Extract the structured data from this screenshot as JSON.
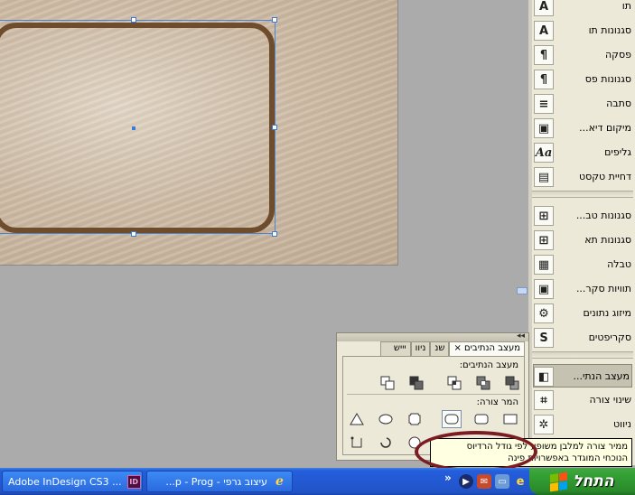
{
  "right_panel": {
    "items": [
      {
        "label": "תו",
        "icon": "character-icon",
        "glyph": "A"
      },
      {
        "label": "סגנונות תו",
        "icon": "character-styles-icon",
        "glyph": "A"
      },
      {
        "label": "פסקה",
        "icon": "paragraph-icon",
        "glyph": "¶"
      },
      {
        "label": "סגנונות פס",
        "icon": "paragraph-styles-icon",
        "glyph": "¶"
      },
      {
        "label": "סתבה",
        "icon": "story-icon",
        "glyph": "≡"
      },
      {
        "label": "מיקום דיא...",
        "icon": "image-position-icon",
        "glyph": "▣"
      },
      {
        "label": "גליפים",
        "icon": "glyphs-icon",
        "glyph": "Aa"
      },
      {
        "label": "דחיית טקסט",
        "icon": "text-wrap-icon",
        "glyph": "▤"
      },
      {
        "label": "סגנונות טב...",
        "icon": "table-styles-icon",
        "glyph": "⊞"
      },
      {
        "label": "סגנונות תא",
        "icon": "cell-styles-icon",
        "glyph": "⊞"
      },
      {
        "label": "טבלה",
        "icon": "table-icon",
        "glyph": "▦"
      },
      {
        "label": "תוויות סקר...",
        "icon": "captions-icon",
        "glyph": "▣"
      },
      {
        "label": "מיזוג נתונים",
        "icon": "data-merge-icon",
        "glyph": "⚙"
      },
      {
        "label": "סקריפטים",
        "icon": "scripts-icon",
        "glyph": "S"
      },
      {
        "label": "מעצב הנתי...",
        "icon": "pathfinder-icon",
        "glyph": "◧"
      },
      {
        "label": "שינוי צורה",
        "icon": "transform-icon",
        "glyph": "⌗"
      },
      {
        "label": "ניווט",
        "icon": "navigator-icon",
        "glyph": "✲"
      }
    ]
  },
  "pathfinder": {
    "tabs": [
      {
        "label": "מעצב הנתיבים"
      },
      {
        "label": "שנ"
      },
      {
        "label": "ניוו"
      },
      {
        "label": "יייש"
      }
    ],
    "close_glyph": "×",
    "collapse_glyph": "◂◂",
    "section_paths": "מעצב הנתיבים:",
    "section_convert": "המר צורה:"
  },
  "tooltip": {
    "line1": "ממיר צורה למלבן משופע לפי גודל הרדיוס",
    "line2": "הנוכחי המוגדר באפשרויות פינה"
  },
  "taskbar": {
    "start_label": "התחל",
    "tasks": [
      {
        "label": "... Adobe InDesign CS3",
        "icon": "indesign-icon",
        "badge": "ID"
      },
      {
        "label": "עיצוב גרפי - p - Prog...",
        "icon": "internet-explorer-icon",
        "badge": "e"
      }
    ],
    "tray_chevron": "»"
  },
  "colors": {
    "frame_stroke": "#6e4c2c",
    "selection": "#4a86d8",
    "taskbar": "#245edc",
    "start": "#36a336",
    "highlight": "#7a1c22"
  }
}
